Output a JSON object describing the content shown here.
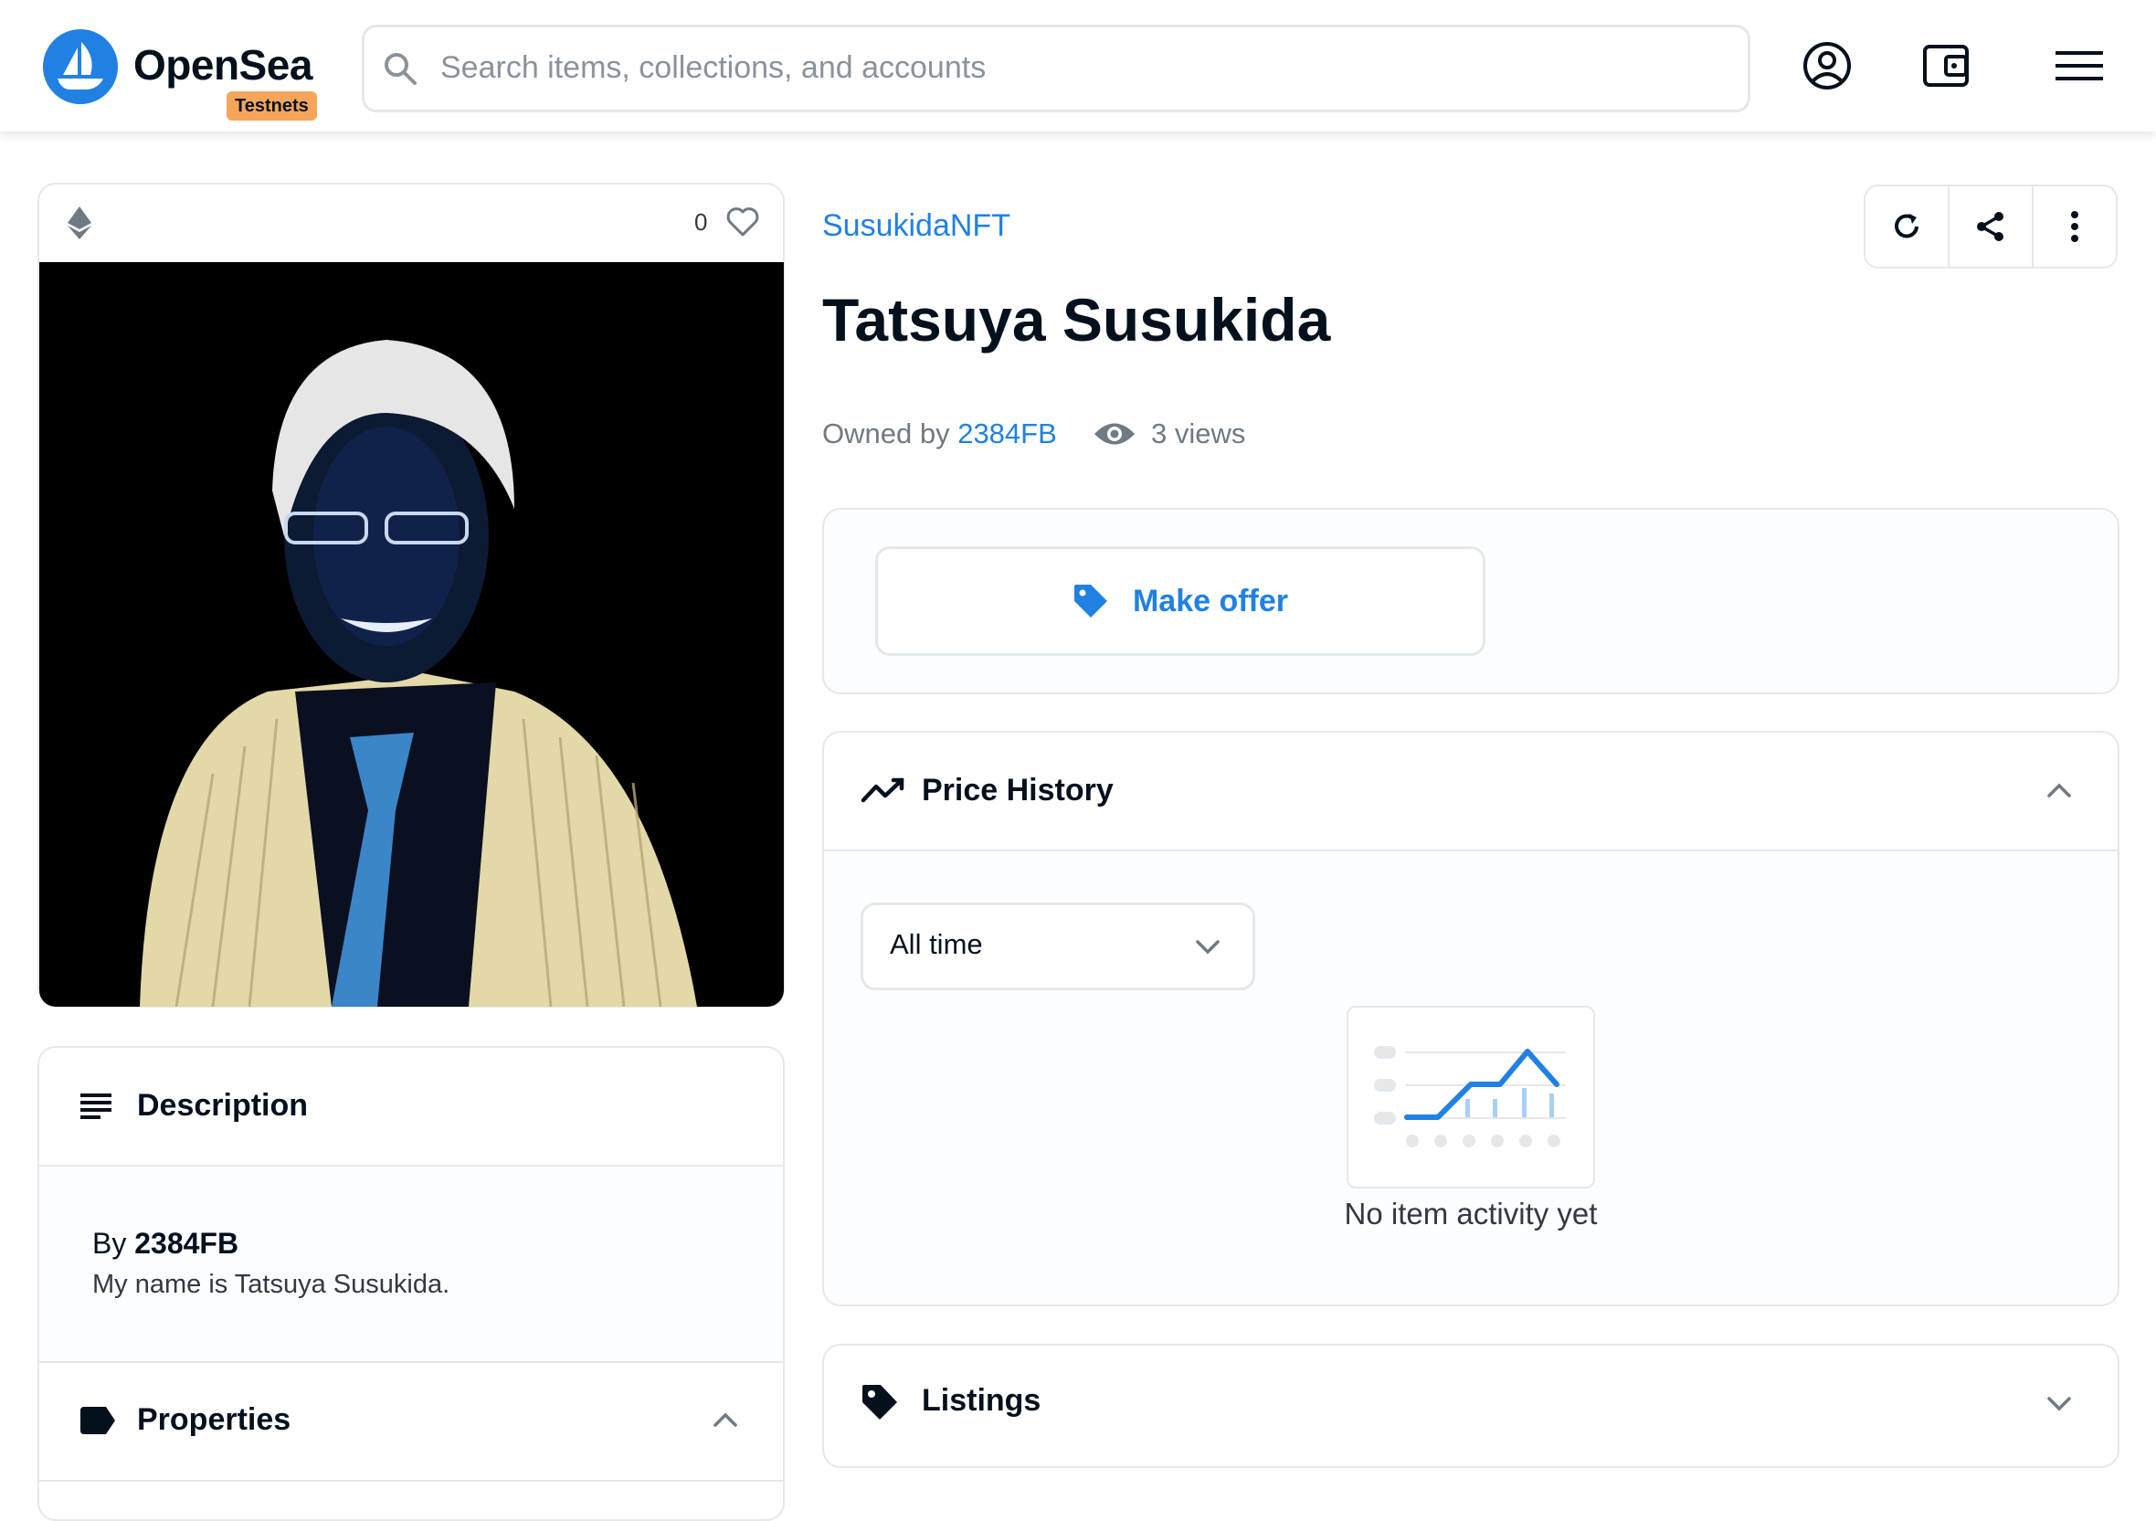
{
  "header": {
    "brand": "OpenSea",
    "badge": "Testnets",
    "search_placeholder": "Search items, collections, and accounts",
    "icons": [
      "account-icon",
      "wallet-icon",
      "menu-icon"
    ]
  },
  "item": {
    "chain_icon": "ethereum-icon",
    "favorites_count": "0",
    "collection": "SusukidaNFT",
    "title": "Tatsuya Susukida",
    "owned_by_label": "Owned by",
    "owner": "2384FB",
    "views": "3 views"
  },
  "actions": [
    "refresh-icon",
    "share-icon",
    "more-icon"
  ],
  "description_panel": {
    "title": "Description",
    "by_label": "By",
    "creator": "2384FB",
    "text": "My name is Tatsuya Susukida."
  },
  "properties_panel": {
    "title": "Properties"
  },
  "offer": {
    "button_label": "Make offer"
  },
  "price_history": {
    "title": "Price History",
    "period": "All time",
    "empty_text": "No item activity yet"
  },
  "listings": {
    "title": "Listings"
  },
  "colors": {
    "accent": "#2081e2",
    "badge": "#f6a65a",
    "border": "#e5e8eb",
    "text": "#04111d",
    "muted": "#707a83"
  }
}
